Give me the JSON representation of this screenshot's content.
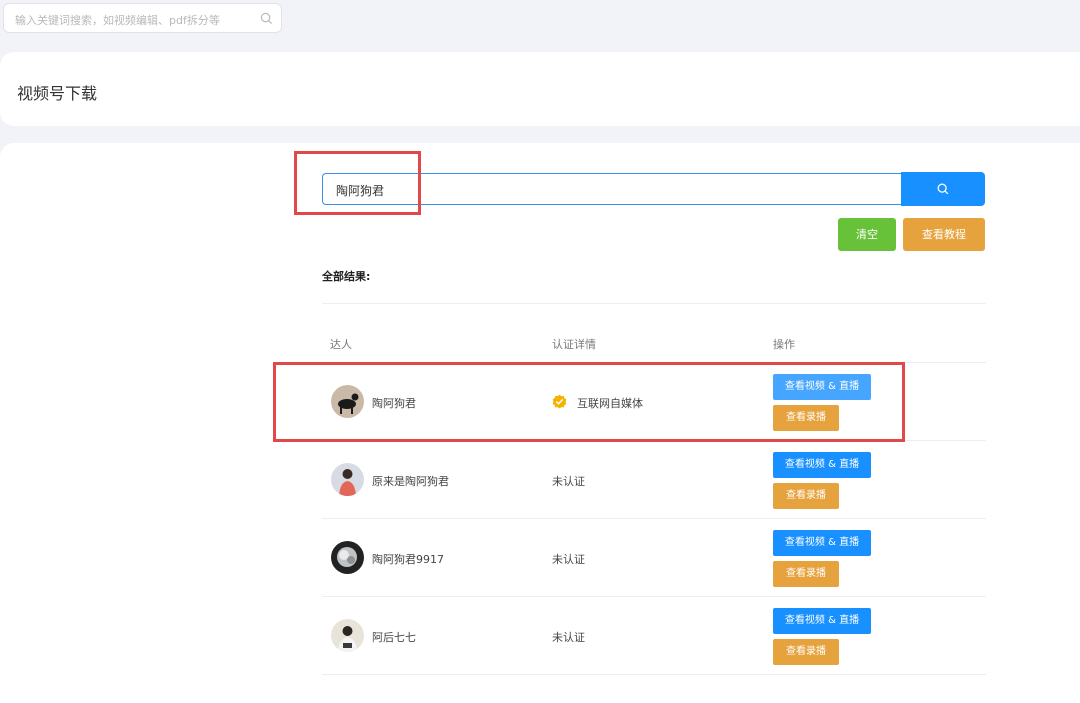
{
  "top_search": {
    "placeholder": "输入关键词搜索，如视频编辑、pdf拆分等"
  },
  "page_title": "视频号下载",
  "search": {
    "value": "陶阿狗君"
  },
  "buttons": {
    "clear": "清空",
    "tutorial": "查看教程"
  },
  "results_label": "全部结果:",
  "table": {
    "headers": [
      "达人",
      "认证详情",
      "操作"
    ],
    "rows": [
      {
        "name": "陶阿狗君",
        "cert": "互联网自媒体",
        "verified": true,
        "video_label": "查看视频 & 直播",
        "record_label": "查看录播"
      },
      {
        "name": "原来是陶阿狗君",
        "cert": "未认证",
        "verified": false,
        "video_label": "查看视频 & 直播",
        "record_label": "查看录播"
      },
      {
        "name": "陶阿狗君9917",
        "cert": "未认证",
        "verified": false,
        "video_label": "查看视频 & 直播",
        "record_label": "查看录播"
      },
      {
        "name": "阿后七七",
        "cert": "未认证",
        "verified": false,
        "video_label": "查看视频 & 直播",
        "record_label": "查看录播"
      }
    ]
  },
  "colors": {
    "primary": "#1890ff",
    "success": "#67c23a",
    "warning": "#e6a23c",
    "highlight": "#e2474a",
    "verified_badge": "#f5b300"
  }
}
